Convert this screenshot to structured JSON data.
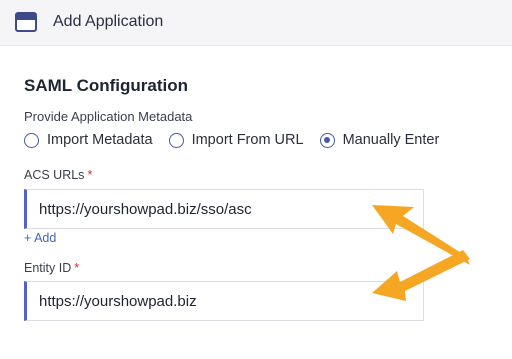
{
  "header": {
    "icon": "application-window-icon",
    "title": "Add Application"
  },
  "saml": {
    "section_title": "SAML Configuration",
    "metadata_label": "Provide Application Metadata",
    "metadata_options": [
      {
        "label": "Import Metadata",
        "checked": false
      },
      {
        "label": "Import From URL",
        "checked": false
      },
      {
        "label": "Manually Enter",
        "checked": true
      }
    ],
    "acs_urls": {
      "label": "ACS URLs",
      "required_mark": "*",
      "value": "https://yourshowpad.biz/sso/asc",
      "add_label": "+ Add"
    },
    "entity_id": {
      "label": "Entity ID",
      "required_mark": "*",
      "value": "https://yourshowpad.biz"
    }
  },
  "annotation": {
    "arrow_color": "#f5a623"
  }
}
